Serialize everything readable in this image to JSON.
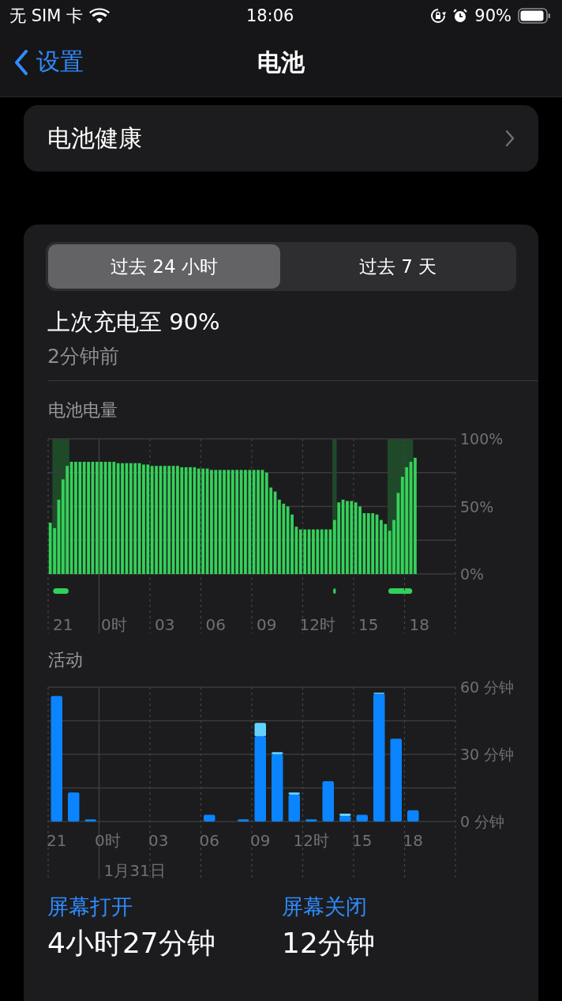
{
  "status_bar": {
    "carrier": "无 SIM 卡",
    "time": "18:06",
    "battery_percent": "90%"
  },
  "nav": {
    "back": "设置",
    "title": "电池"
  },
  "health_row": {
    "label": "电池健康"
  },
  "segments": [
    {
      "label": "过去 24 小时",
      "selected": true
    },
    {
      "label": "过去 7 天",
      "selected": false
    }
  ],
  "last_charge": {
    "title": "上次充电至 90%",
    "subtitle": "2分钟前"
  },
  "battery_chart": {
    "chart_data": {
      "type": "bar",
      "title": "电池电量",
      "grid": true,
      "categories": [
        null,
        null,
        null,
        "21",
        null,
        null,
        null,
        null,
        null,
        null,
        null,
        null,
        null,
        null,
        null,
        "0时",
        null,
        null,
        null,
        null,
        null,
        null,
        null,
        null,
        null,
        null,
        null,
        "03",
        null,
        null,
        null,
        null,
        null,
        null,
        null,
        null,
        null,
        null,
        null,
        "06",
        null,
        null,
        null,
        null,
        null,
        null,
        null,
        null,
        null,
        null,
        null,
        "09",
        null,
        null,
        null,
        null,
        null,
        null,
        null,
        null,
        null,
        null,
        null,
        "12时",
        null,
        null,
        null,
        null,
        null,
        null,
        null,
        null,
        null,
        null,
        null,
        "15",
        null,
        null,
        null,
        null,
        null,
        null,
        null,
        null,
        null,
        null,
        null,
        "18",
        null,
        null,
        null,
        null,
        null,
        null,
        null,
        null
      ],
      "values": [
        38,
        34,
        55,
        70,
        80,
        83,
        83,
        83,
        83,
        83,
        83,
        83,
        83,
        83,
        83,
        83,
        82,
        82,
        82,
        82,
        82,
        82,
        81,
        81,
        80,
        80,
        80,
        80,
        80,
        80,
        80,
        79,
        79,
        79,
        79,
        78,
        78,
        78,
        77,
        77,
        77,
        77,
        77,
        77,
        77,
        77,
        77,
        77,
        77,
        77,
        77,
        75,
        64,
        61,
        55,
        52,
        50,
        44,
        35,
        33,
        33,
        33,
        33,
        33,
        33,
        33,
        33,
        40,
        53,
        55,
        54,
        54,
        53,
        50,
        45,
        45,
        45,
        44,
        40,
        37,
        32,
        40,
        60,
        72,
        79,
        83,
        86,
        null,
        null,
        null,
        null,
        null,
        null,
        null,
        null,
        null
      ],
      "ylim": [
        0,
        100
      ],
      "yticks": [
        {
          "value": 0,
          "label": "0%"
        },
        {
          "value": 50,
          "label": "50%"
        },
        {
          "value": 100,
          "label": "100%"
        }
      ]
    },
    "charging": [
      false,
      true,
      true,
      true,
      true,
      false,
      false,
      false,
      false,
      false,
      false,
      false,
      false,
      false,
      false,
      false,
      false,
      false,
      false,
      false,
      false,
      false,
      false,
      false,
      false,
      false,
      false,
      false,
      false,
      false,
      false,
      false,
      false,
      false,
      false,
      false,
      false,
      false,
      false,
      false,
      false,
      false,
      false,
      false,
      false,
      false,
      false,
      false,
      false,
      false,
      false,
      false,
      false,
      false,
      false,
      false,
      false,
      false,
      false,
      false,
      false,
      false,
      false,
      false,
      false,
      false,
      false,
      true,
      false,
      false,
      false,
      false,
      false,
      false,
      false,
      false,
      false,
      false,
      false,
      false,
      true,
      true,
      true,
      true,
      true,
      true,
      false
    ]
  },
  "activity_chart": {
    "date_label": "1月31日",
    "chart_data": {
      "type": "bar",
      "title": "活动",
      "stacked": true,
      "grid": true,
      "categories": [
        "21",
        null,
        null,
        "0时",
        null,
        null,
        "03",
        null,
        null,
        "06",
        null,
        null,
        "09",
        null,
        null,
        "12时",
        null,
        null,
        "15",
        null,
        null,
        "18",
        null,
        null
      ],
      "series": [
        {
          "color": "#0a84ff",
          "values": [
            56,
            13,
            1,
            0,
            0,
            0,
            0,
            0,
            0,
            3,
            0,
            1,
            38,
            30,
            12,
            1,
            18,
            2.5,
            3,
            57,
            37,
            5,
            null,
            null
          ]
        },
        {
          "color": "#64d2ff",
          "values": [
            0,
            0,
            0,
            0,
            0,
            0,
            0,
            0,
            0,
            0,
            0,
            0,
            6,
            1,
            1,
            0,
            0,
            1,
            0,
            0.5,
            0,
            0,
            null,
            null
          ]
        }
      ],
      "ylim": [
        0,
        60
      ],
      "yticks": [
        {
          "value": 0,
          "label": "0 分钟"
        },
        {
          "value": 30,
          "label": "30 分钟"
        },
        {
          "value": 60,
          "label": "60 分钟"
        }
      ]
    }
  },
  "totals": [
    {
      "label": "屏幕打开",
      "value": "4小时27分钟"
    },
    {
      "label": "屏幕关闭",
      "value": "12分钟"
    }
  ]
}
